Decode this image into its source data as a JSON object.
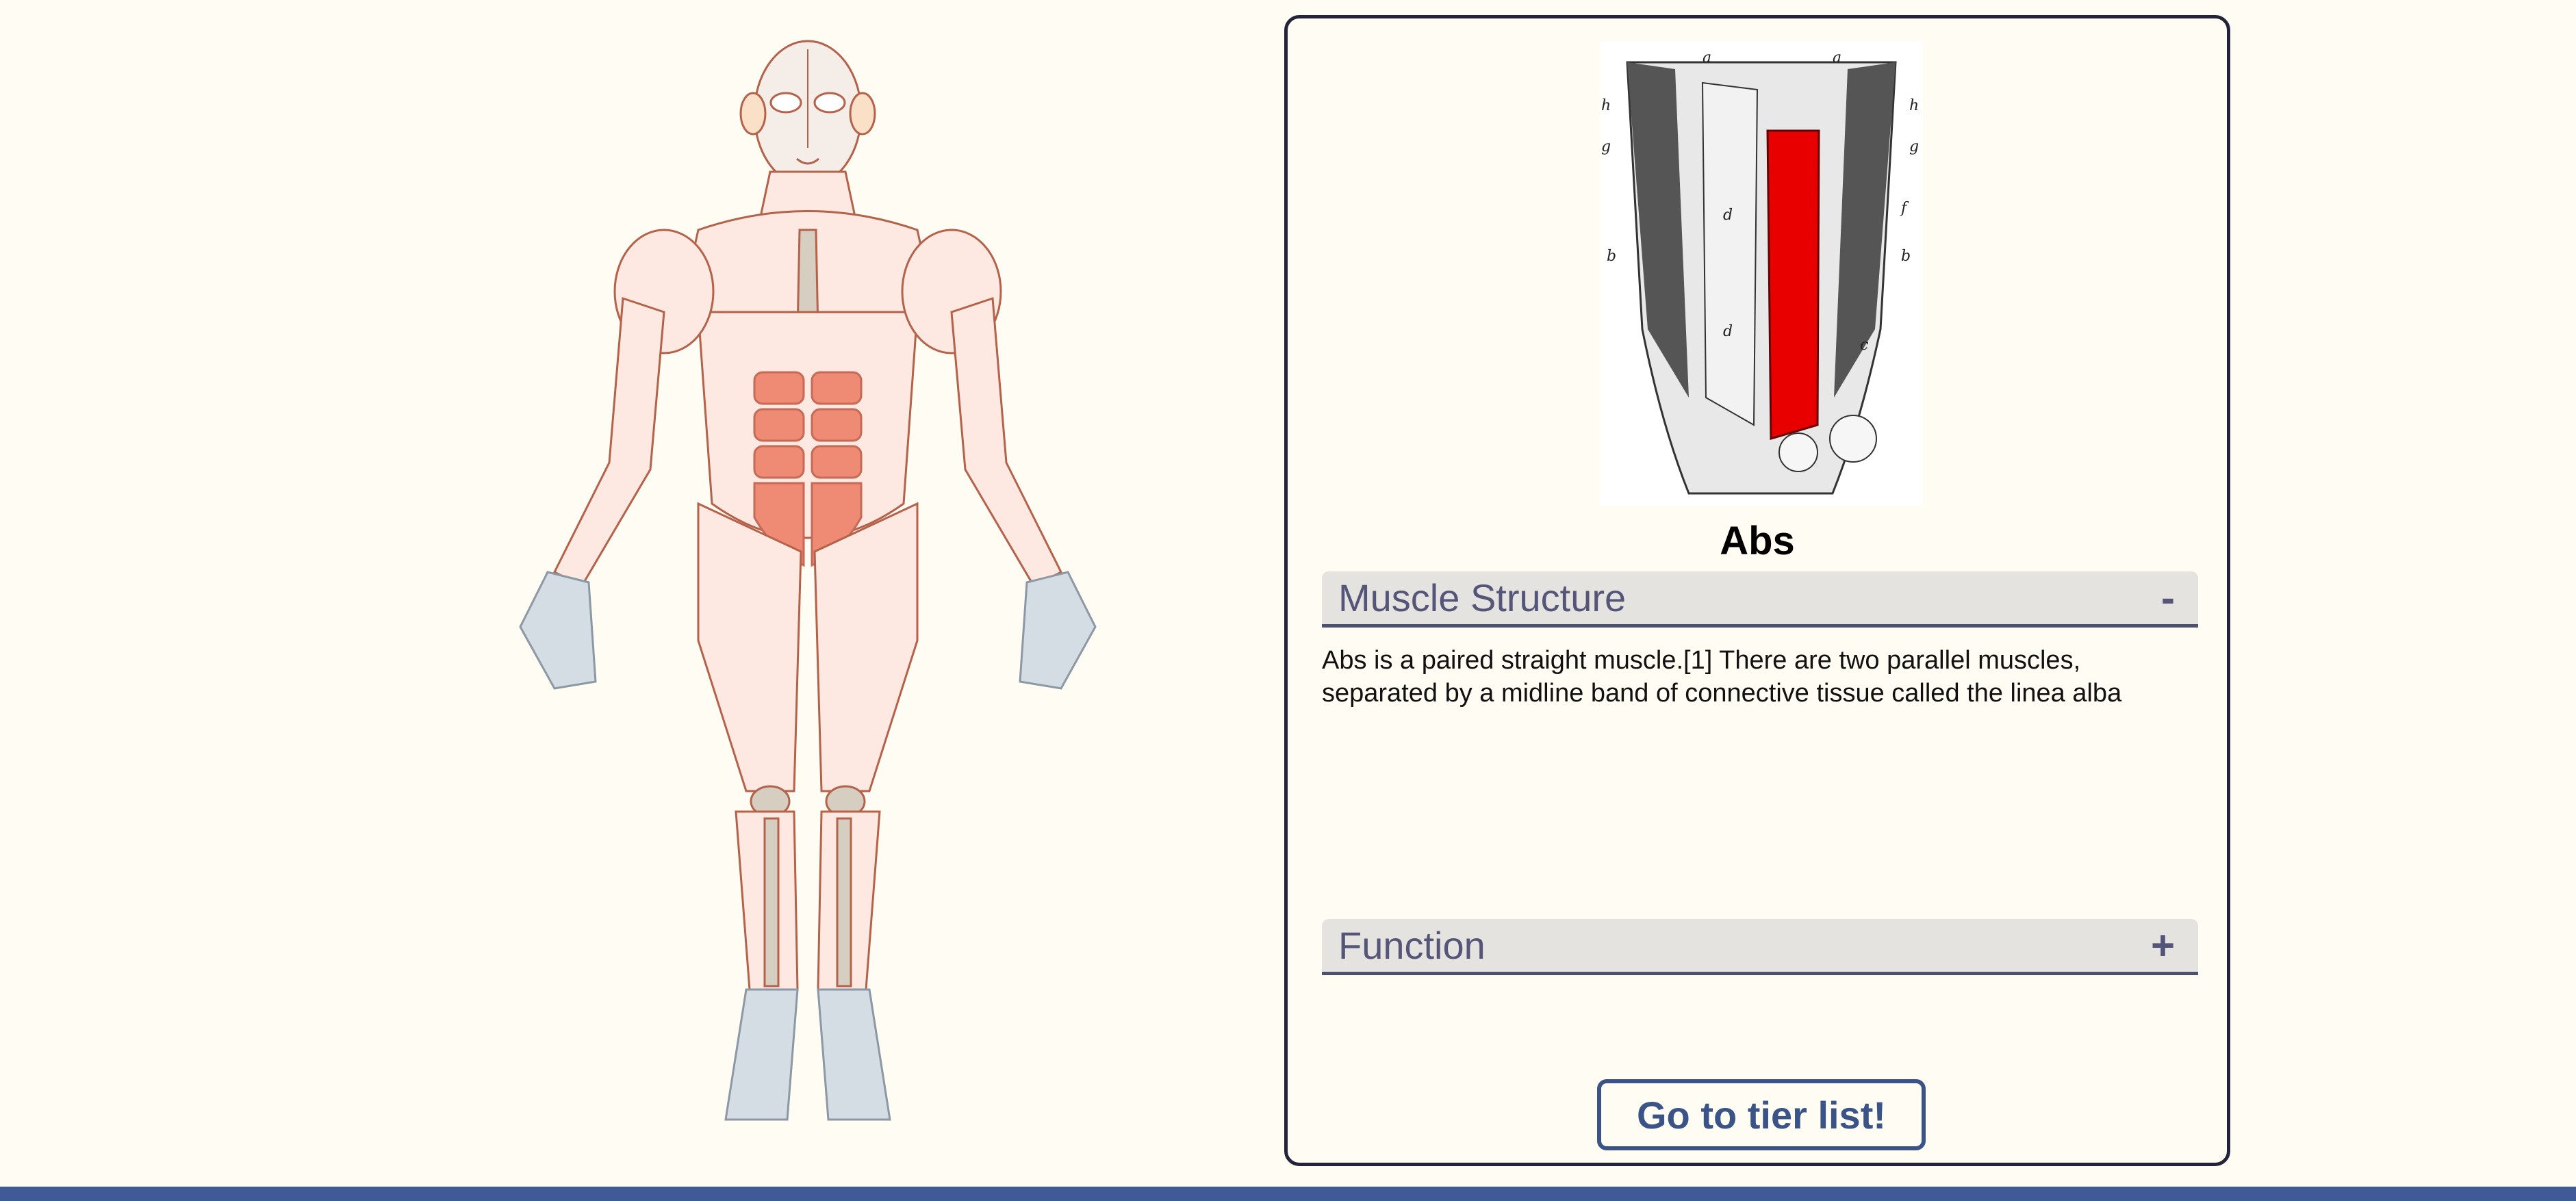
{
  "colors": {
    "background": "#fffcf3",
    "panel_border": "#23233a",
    "accordion_bg": "#e5e3df",
    "accordion_text": "#55557a",
    "accent_blue": "#3a5488",
    "footer_bar": "#3f5a96",
    "muscle_skin": "#fde9e1",
    "muscle_outline": "#b5624a",
    "highlight_muscle": "#ef8a74",
    "bone": "#d6cec0",
    "cartilage": "#d4dce4",
    "illustration_red": "#e80000"
  },
  "body_map": {
    "highlighted_muscle": "abs"
  },
  "illustration": {
    "letters": [
      "a",
      "a",
      "h",
      "h",
      "g",
      "g",
      "f",
      "b",
      "b",
      "d",
      "d",
      "c"
    ]
  },
  "muscle": {
    "name": "Abs"
  },
  "sections": [
    {
      "title": "Muscle Structure",
      "toggle": "-",
      "expanded": true,
      "text": "Abs is a paired straight muscle.[1] There are two parallel muscles, separated by a midline band of connective tissue called the linea alba"
    },
    {
      "title": "Function",
      "toggle": "+",
      "expanded": false
    }
  ],
  "cta": {
    "label": "Go to tier list!"
  }
}
